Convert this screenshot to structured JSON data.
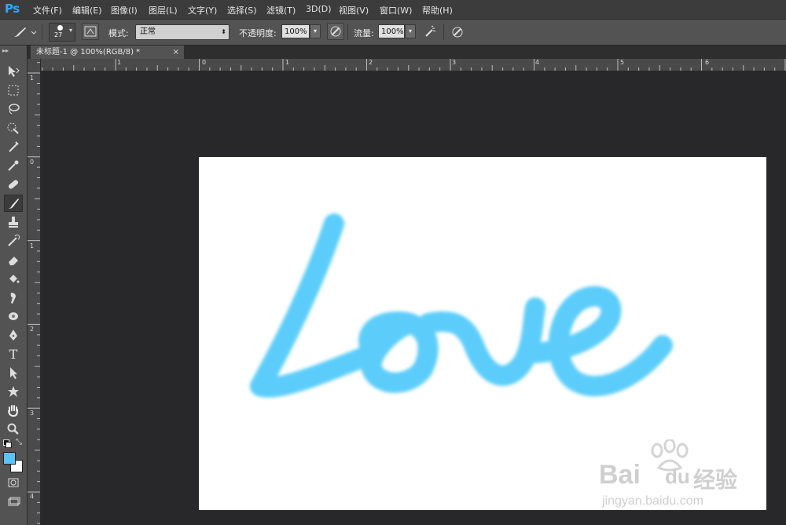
{
  "app": {
    "logo": "Ps"
  },
  "menu": [
    "文件(F)",
    "编辑(E)",
    "图像(I)",
    "图层(L)",
    "文字(Y)",
    "选择(S)",
    "滤镜(T)",
    "3D(D)",
    "视图(V)",
    "窗口(W)",
    "帮助(H)"
  ],
  "options": {
    "brush_size": "27",
    "mode_label": "模式:",
    "mode_value": "正常",
    "opacity_label": "不透明度:",
    "opacity_value": "100%",
    "flow_label": "流量:",
    "flow_value": "100%"
  },
  "document": {
    "tab_title": "未标题-1 @ 100%(RGB/8) *",
    "close": "×"
  },
  "rulers": {
    "horizontal": [
      "1",
      "0",
      "1",
      "2",
      "3",
      "4",
      "5",
      "6"
    ],
    "vertical": [
      "1",
      "0",
      "1",
      "2",
      "3",
      "4"
    ]
  },
  "canvas": {
    "drawing_text": "Love",
    "stroke_color": "#5bcdfa",
    "background": "#ffffff"
  },
  "colors": {
    "foreground": "#5bc3f5",
    "background": "#ffffff"
  },
  "watermark": {
    "brand": "Bai",
    "brand2": "du",
    "cn": "经验",
    "url": "jingyan.baidu.com"
  }
}
